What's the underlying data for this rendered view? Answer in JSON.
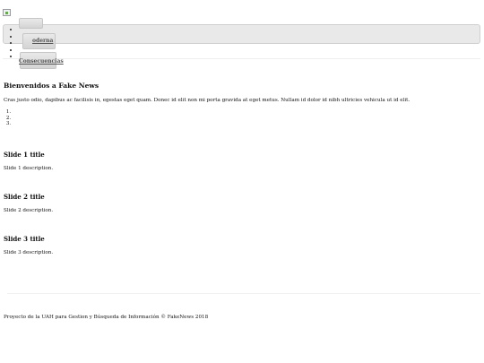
{
  "nav": {
    "items": [
      {
        "label": ""
      },
      {
        "label": ""
      },
      {
        "label": "oderna"
      },
      {
        "label": ""
      },
      {
        "label": "Consecuencias"
      }
    ]
  },
  "intro": {
    "title": "Bienvenidos a Fake News",
    "text": "Cras justo odio, dapibus ac facilisis in, egestas eget quam. Donec id elit non mi porta gravida at eget metus. Nullam id dolor id nibh ultricies vehicula ut id elit."
  },
  "carousel": {
    "indicators": [
      "",
      "",
      ""
    ],
    "slides": [
      {
        "title": "Slide 1 title",
        "description": "Slide 1 description."
      },
      {
        "title": "Slide 2 title",
        "description": "Slide 2 description."
      },
      {
        "title": "Slide 3 title",
        "description": "Slide 3 description."
      }
    ]
  },
  "footer": {
    "text": "Proyecto de la UAH para Gestion y Búsqueda de Información © FakeNews 2018"
  }
}
